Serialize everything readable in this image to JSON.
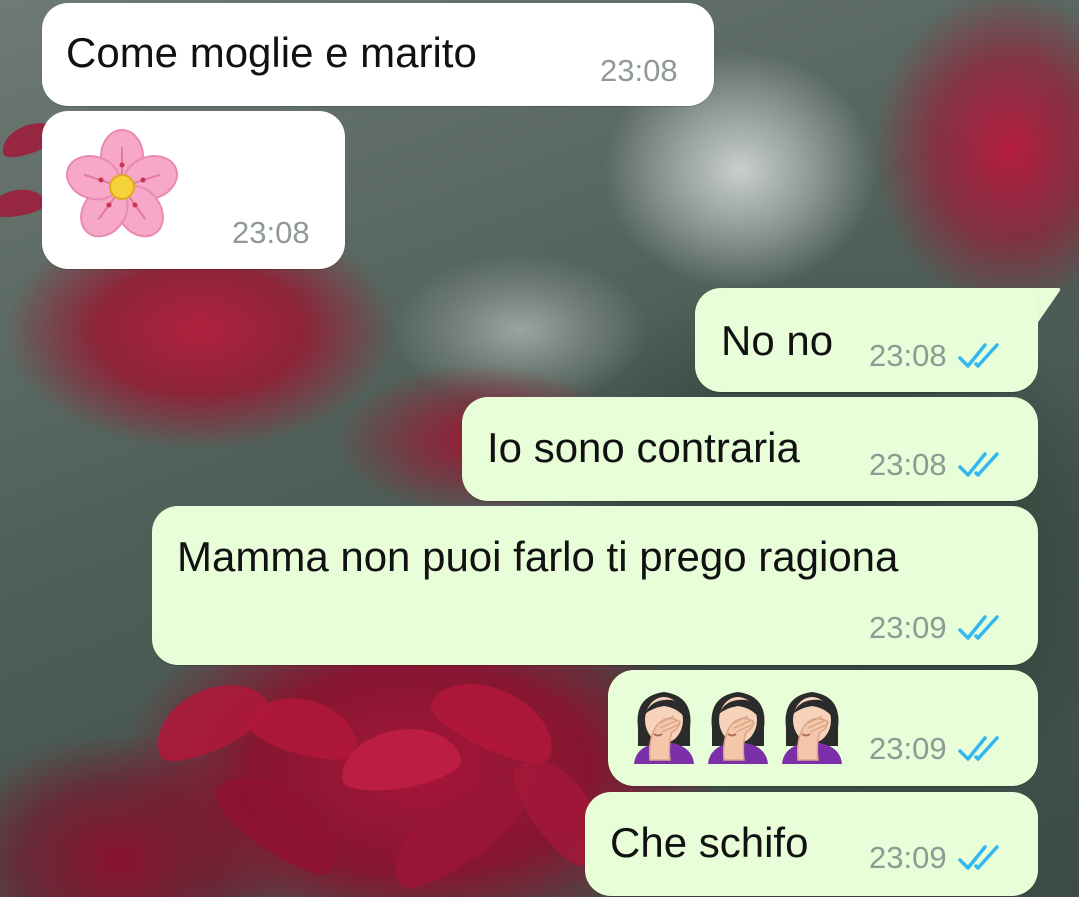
{
  "app": "WhatsApp",
  "chat": {
    "messages": [
      {
        "direction": "incoming",
        "kind": "text",
        "text": "Come moglie e marito",
        "time": "23:08"
      },
      {
        "direction": "incoming",
        "kind": "emoji",
        "emoji": "cherry-blossom-emoji",
        "time": "23:08"
      },
      {
        "direction": "outgoing",
        "kind": "text",
        "text": "No no",
        "time": "23:08",
        "status": "read"
      },
      {
        "direction": "outgoing",
        "kind": "text",
        "text": "Io sono contraria",
        "time": "23:08",
        "status": "read"
      },
      {
        "direction": "outgoing",
        "kind": "text",
        "text": "Mamma non puoi farlo ti prego ragiona",
        "time": "23:09",
        "status": "read"
      },
      {
        "direction": "outgoing",
        "kind": "emoji",
        "emoji": "woman-facepalming-emoji ×3",
        "time": "23:09",
        "status": "read"
      },
      {
        "direction": "outgoing",
        "kind": "text",
        "text": "Che schifo",
        "time": "23:09",
        "status": "read"
      }
    ]
  },
  "colors": {
    "incoming_bubble": "#ffffff",
    "outgoing_bubble": "#e7fed8",
    "read_ticks": "#34b7f1",
    "timestamp": "#8f9a95"
  }
}
